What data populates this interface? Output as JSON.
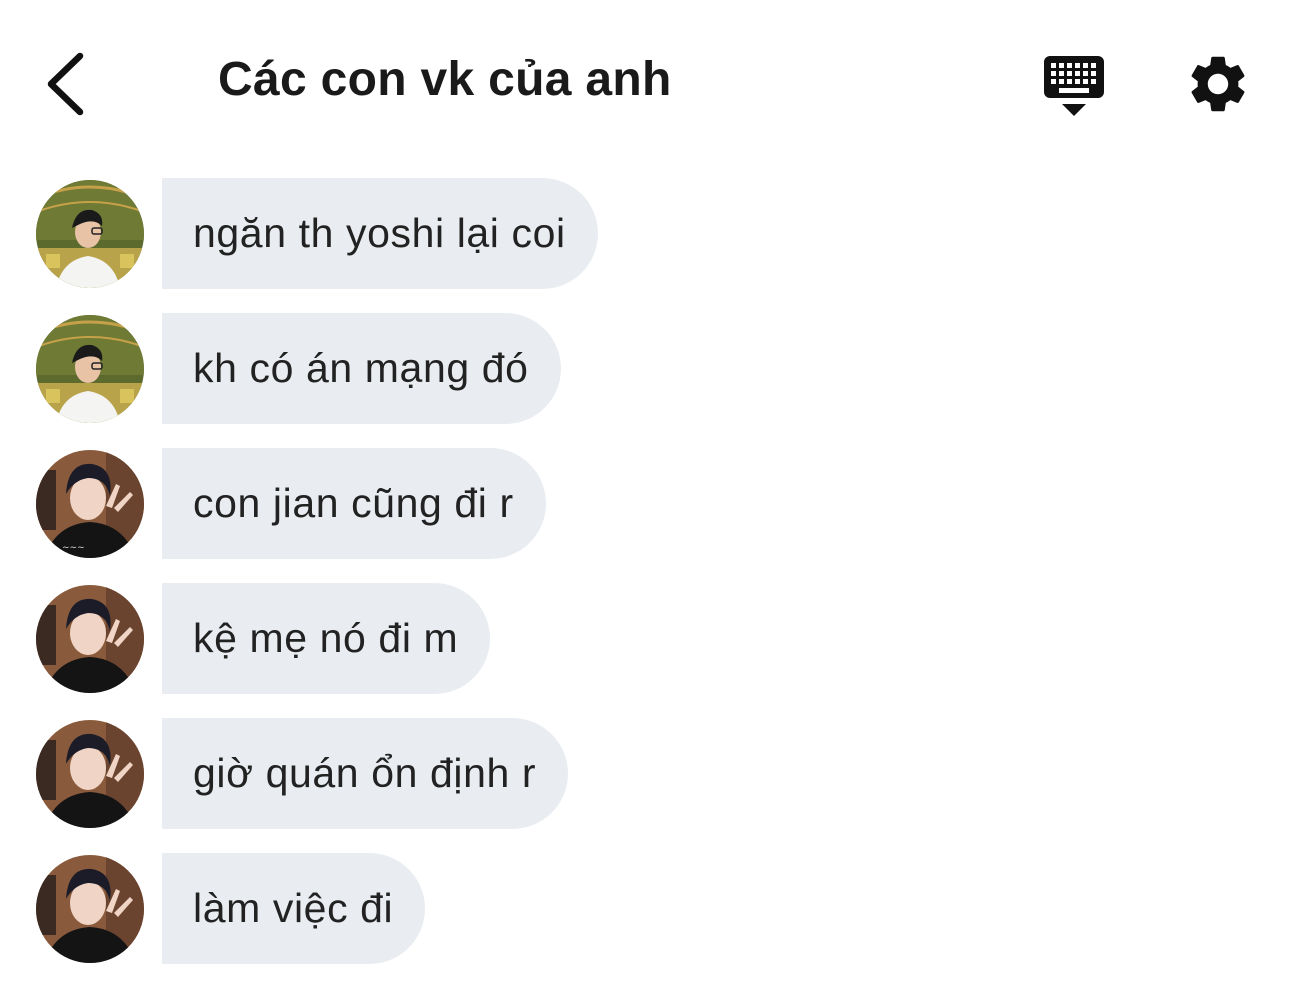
{
  "header": {
    "title": "Các con vk của anh",
    "back_icon": "chevron-left-icon",
    "keyboard_icon": "keyboard-icon",
    "settings_icon": "gear-icon"
  },
  "messages": [
    {
      "sender": "user-a",
      "text": "ngăn th yoshi lại coi"
    },
    {
      "sender": "user-a",
      "text": "kh có án mạng đó"
    },
    {
      "sender": "user-b",
      "text": "con jian cũng đi r"
    },
    {
      "sender": "user-b",
      "text": "kệ mẹ nó đi m"
    },
    {
      "sender": "user-b",
      "text": "giờ quán ổn định r"
    },
    {
      "sender": "user-b",
      "text": "làm việc đi"
    }
  ],
  "colors": {
    "bubble": "#e9edf1",
    "text": "#222222",
    "icon": "#111111",
    "background": "#ffffff"
  }
}
